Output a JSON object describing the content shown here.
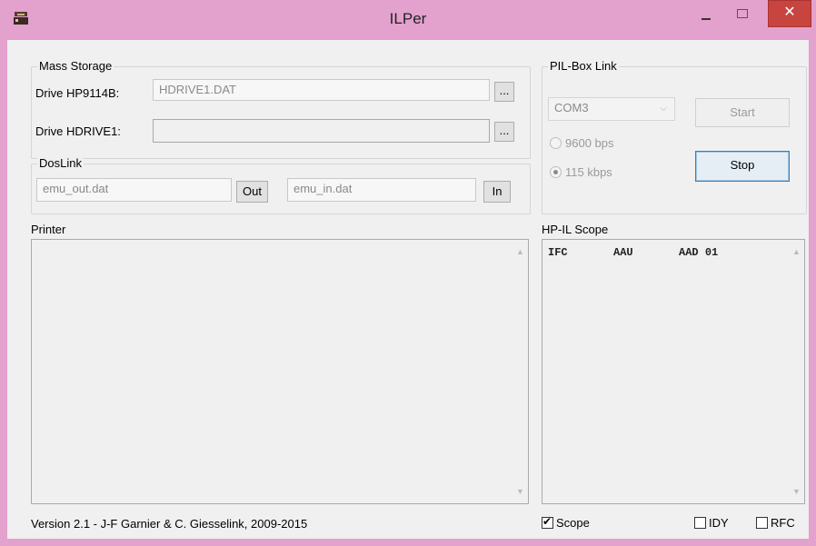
{
  "window": {
    "title": "ILPer",
    "close_glyph": "✕"
  },
  "mass_storage": {
    "legend": "Mass Storage",
    "drive1": {
      "label": "Drive HP9114B:",
      "value": "HDRIVE1.DAT",
      "browse": "..."
    },
    "drive2": {
      "label": "Drive HDRIVE1:",
      "value": "",
      "browse": "..."
    }
  },
  "doslink": {
    "legend": "DosLink",
    "out_file": "emu_out.dat",
    "out_button": "Out",
    "in_file": "emu_in.dat",
    "in_button": "In"
  },
  "pilbox": {
    "legend": "PIL-Box Link",
    "port": "COM3",
    "start": "Start",
    "stop": "Stop",
    "baud_9600": "9600 bps",
    "baud_115k": "115 kbps",
    "selected_baud": "115 kbps"
  },
  "printer": {
    "label": "Printer"
  },
  "scope": {
    "label": "HP-IL Scope",
    "line": "IFC       AAU       AAD 01",
    "scope_checkbox": "Scope",
    "idy_checkbox": "IDY",
    "rfc_checkbox": "RFC",
    "scope_checked": true,
    "idy_checked": false,
    "rfc_checked": false
  },
  "status": {
    "version": "Version 2.1  -  J-F Garnier & C. Giesselink, 2009-2015"
  },
  "colors": {
    "titlebar": "#e3a1ce",
    "close": "#c7443f",
    "client": "#f0f0f0"
  },
  "icons": {
    "app": "app-icon",
    "minimize": "minimize-icon",
    "maximize": "maximize-icon",
    "close": "close-icon"
  }
}
